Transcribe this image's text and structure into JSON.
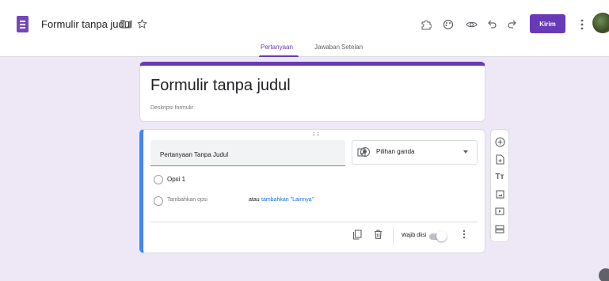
{
  "header": {
    "title": "Formulir tanpa judul",
    "send_label": "Kirim",
    "accent_color": "#673ab7"
  },
  "tabs": [
    {
      "label": "Pertanyaan",
      "active": true
    },
    {
      "label": "Jawaban",
      "active": false
    },
    {
      "label": "Setelan",
      "active": false
    }
  ],
  "form": {
    "title": "Formulir tanpa judul",
    "description_placeholder": "Deskripsi formulir"
  },
  "question": {
    "text": "Pertanyaan Tanpa Judul",
    "type": "Pilihan ganda",
    "options": [
      {
        "label": "Opsi 1"
      }
    ],
    "add_option_label": "Tambahkan opsi",
    "or_label": "atau",
    "add_other_label": "tambahkan \"Lainnya\"",
    "required_label": "Wajib diisi",
    "required": false
  },
  "icons": {
    "toolbar": [
      "addon-icon",
      "palette-icon",
      "preview-icon",
      "undo-icon",
      "redo-icon",
      "more-vert-icon"
    ],
    "side": [
      "add-question-icon",
      "import-questions-icon",
      "add-title-icon",
      "add-image-icon",
      "add-video-icon",
      "add-section-icon"
    ]
  }
}
